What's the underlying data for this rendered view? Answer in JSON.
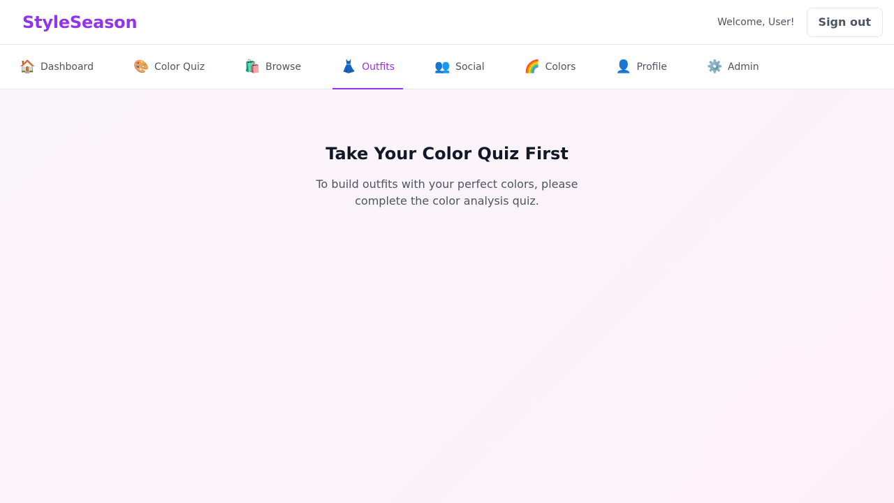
{
  "header": {
    "brand": "StyleSeason",
    "welcome": "Welcome, User!",
    "signout_label": "Sign out"
  },
  "nav": {
    "items": [
      {
        "icon": "🏠",
        "icon_name": "house-icon",
        "label": "Dashboard"
      },
      {
        "icon": "🎨",
        "icon_name": "palette-icon",
        "label": "Color Quiz"
      },
      {
        "icon": "🛍️",
        "icon_name": "shopping-bags-icon",
        "label": "Browse"
      },
      {
        "icon": "👗",
        "icon_name": "dress-icon",
        "label": "Outfits",
        "active": true
      },
      {
        "icon": "👥",
        "icon_name": "people-icon",
        "label": "Social"
      },
      {
        "icon": "🌈",
        "icon_name": "rainbow-icon",
        "label": "Colors"
      },
      {
        "icon": "👤",
        "icon_name": "person-icon",
        "label": "Profile"
      },
      {
        "icon": "⚙️",
        "icon_name": "gear-icon",
        "label": "Admin"
      }
    ]
  },
  "main": {
    "title": "Take Your Color Quiz First",
    "message": "To build outfits with your perfect colors, please complete the color analysis quiz."
  },
  "colors": {
    "accent": "#9333ea",
    "text": "#111827",
    "muted": "#4b5563",
    "background": "#fbf3f9"
  }
}
